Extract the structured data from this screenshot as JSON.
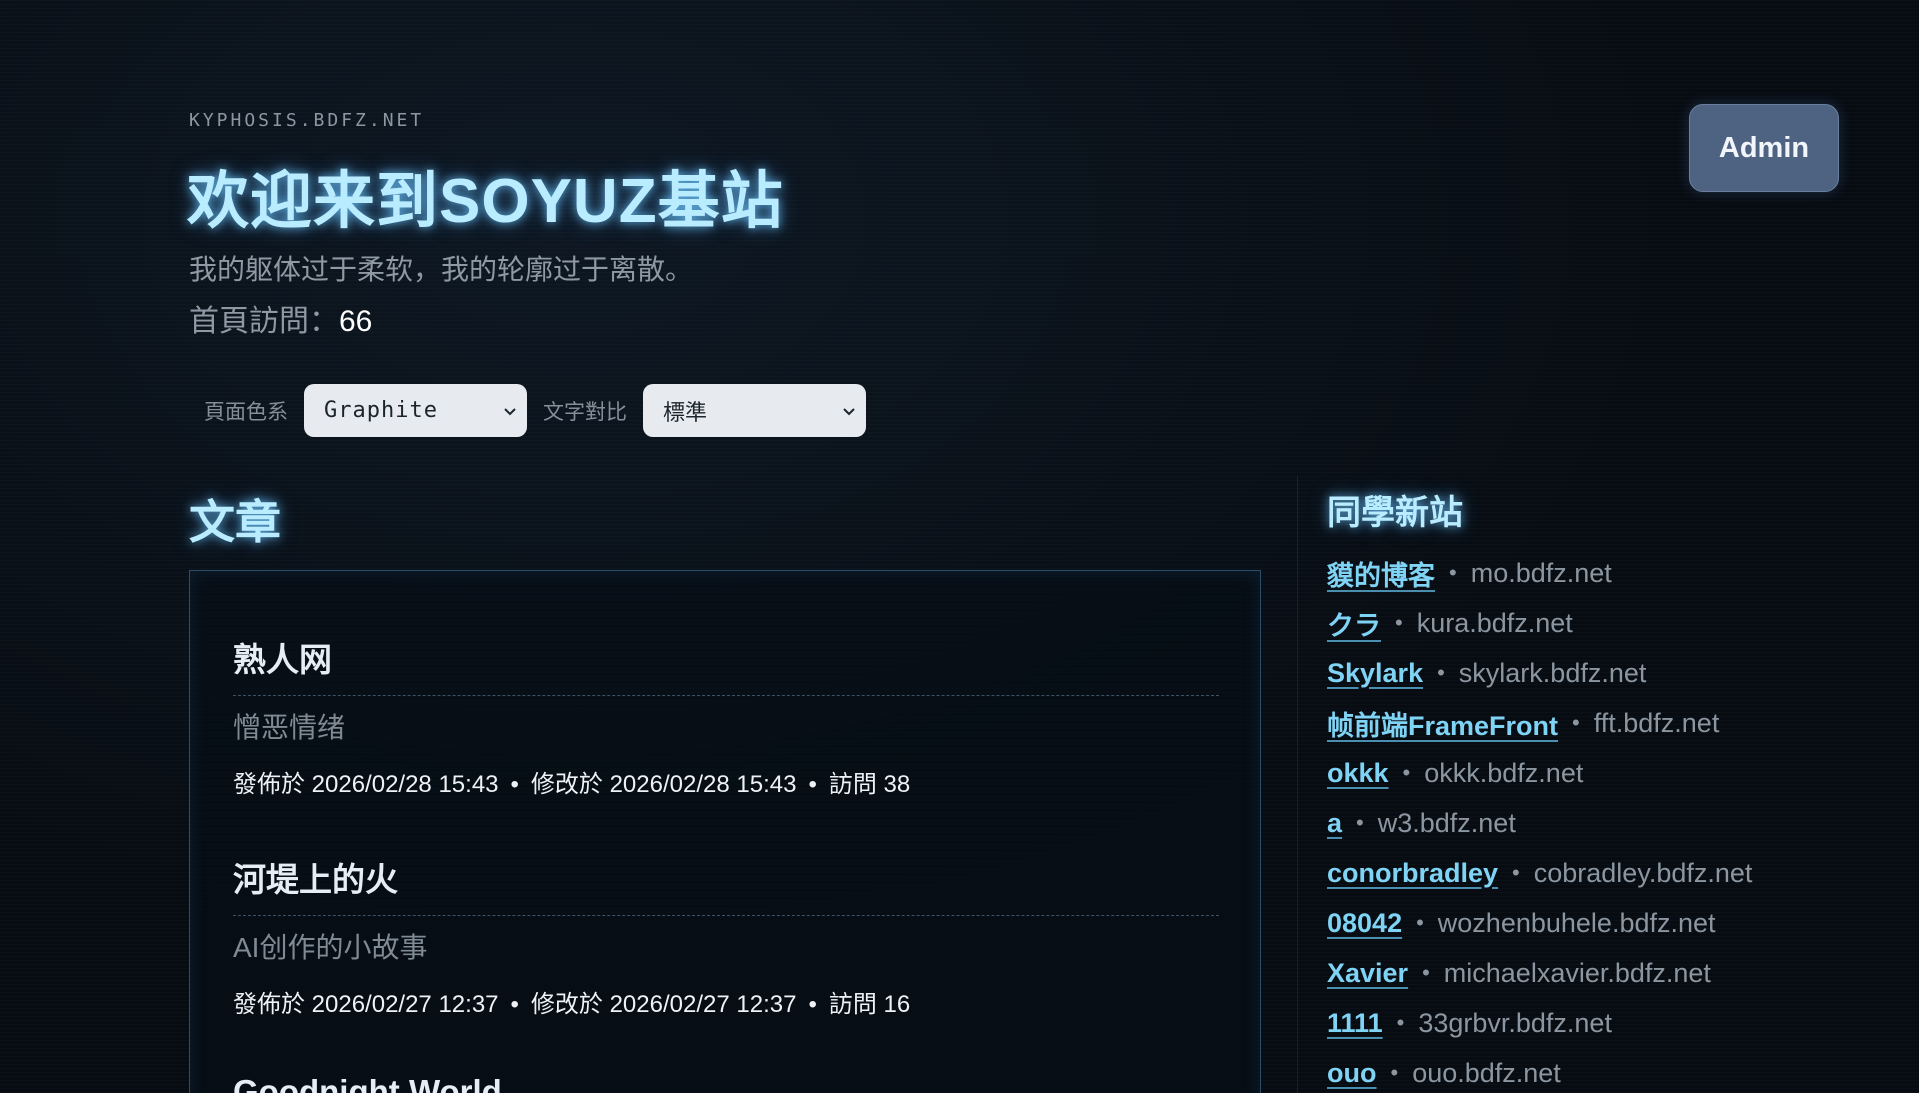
{
  "header": {
    "domain": "KYPHOSIS.BDFZ.NET",
    "title": "欢迎来到SOYUZ基站",
    "subtitle": "我的躯体过于柔软，我的轮廓过于离散。",
    "visits_label": "首頁訪問：",
    "visits_count": "66",
    "admin_label": "Admin"
  },
  "controls": {
    "palette_label": "頁面色系",
    "palette_value": "Graphite",
    "contrast_label": "文字對比",
    "contrast_value": "標準"
  },
  "articles": {
    "title": "文章",
    "items": [
      {
        "title": "熟人网",
        "desc": "憎恶情绪",
        "published": "發佈於 2026/02/28 15:43",
        "modified": "修改於 2026/02/28 15:43",
        "visits": "訪問 38"
      },
      {
        "title": "河堤上的火",
        "desc": "AI创作的小故事",
        "published": "發佈於 2026/02/27 12:37",
        "modified": "修改於 2026/02/27 12:37",
        "visits": "訪問 16"
      },
      {
        "title": "Goodnight World"
      }
    ],
    "meta_sep": "•"
  },
  "friends": {
    "title": "同學新站",
    "sep": "•",
    "items": [
      {
        "name": "貘的博客",
        "domain": "mo.bdfz.net"
      },
      {
        "name": "クラ",
        "domain": "kura.bdfz.net"
      },
      {
        "name": "Skylark",
        "domain": "skylark.bdfz.net"
      },
      {
        "name": "帧前端FrameFront",
        "domain": "fft.bdfz.net"
      },
      {
        "name": "okkk",
        "domain": "okkk.bdfz.net"
      },
      {
        "name": "a",
        "domain": "w3.bdfz.net"
      },
      {
        "name": "conorbradley",
        "domain": "cobradley.bdfz.net"
      },
      {
        "name": "08042",
        "domain": "wozhenbuhele.bdfz.net"
      },
      {
        "name": "Xavier",
        "domain": "michaelxavier.bdfz.net"
      },
      {
        "name": "1111",
        "domain": "33grbvr.bdfz.net"
      },
      {
        "name": "ouo",
        "domain": "ouo.bdfz.net"
      }
    ]
  },
  "colors": {
    "background": "#070c12",
    "title_glow": "#b9ecff",
    "link": "#7fd3f5",
    "admin_button": "#4e6282"
  },
  "icons": {
    "select_arrow": "chevron-down-icon"
  }
}
